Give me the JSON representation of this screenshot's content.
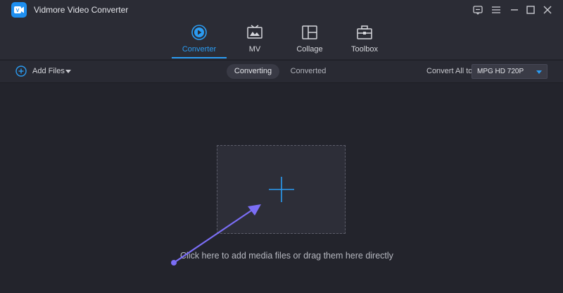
{
  "app": {
    "title": "Vidmore Video Converter"
  },
  "nav": {
    "tabs": [
      {
        "label": "Converter",
        "icon": "converter-icon",
        "active": true
      },
      {
        "label": "MV",
        "icon": "mv-icon",
        "active": false
      },
      {
        "label": "Collage",
        "icon": "collage-icon",
        "active": false
      },
      {
        "label": "Toolbox",
        "icon": "toolbox-icon",
        "active": false
      }
    ]
  },
  "toolbar": {
    "add_files_label": "Add Files",
    "segments": [
      "Converting",
      "Converted"
    ],
    "convert_all_label": "Convert All to:",
    "format_value": "MPG HD 720P"
  },
  "main": {
    "hint": "Click here to add media files or drag them here directly"
  },
  "colors": {
    "accent": "#2b9cf2",
    "background": "#23242c",
    "annotation_arrow": "#7b6ef6"
  }
}
